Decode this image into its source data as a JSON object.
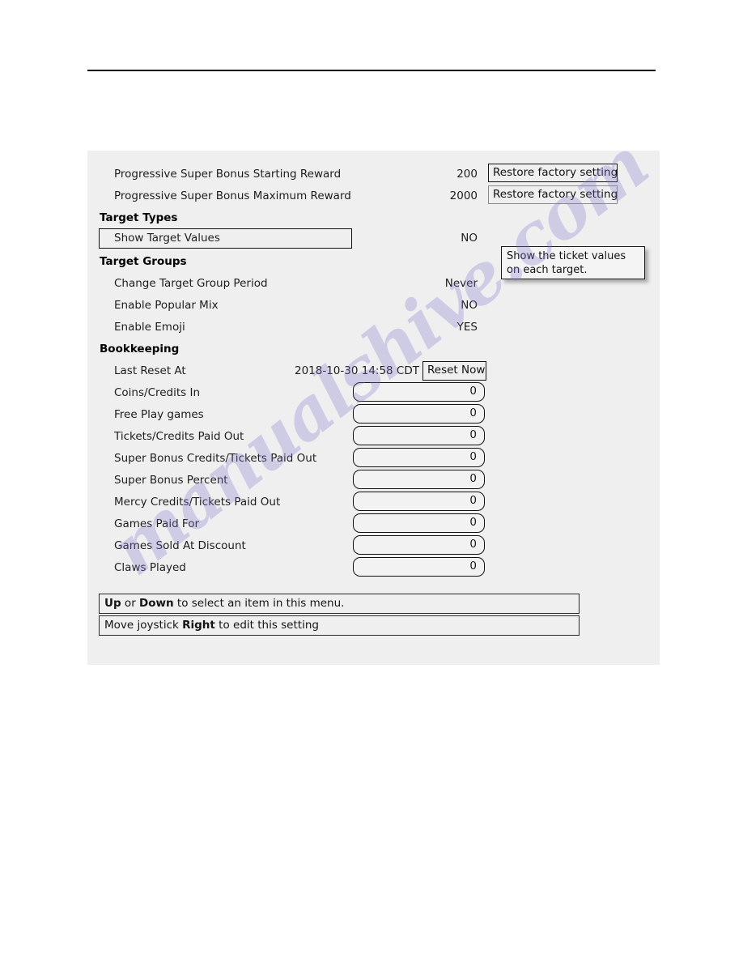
{
  "page": {
    "watermark": "manualshive.com"
  },
  "panel": {
    "rows": [
      {
        "kind": "item",
        "label": "Progressive Super Bonus Starting Reward",
        "value": "200"
      },
      {
        "kind": "item",
        "label": "Progressive Super Bonus Maximum Reward",
        "value": "2000"
      },
      {
        "kind": "group",
        "label": "Target Types",
        "value": ""
      },
      {
        "kind": "selected",
        "label": "Show Target Values",
        "value": "NO"
      },
      {
        "kind": "group",
        "label": "Target Groups",
        "value": ""
      },
      {
        "kind": "item",
        "label": "Change Target Group Period",
        "value": "Never"
      },
      {
        "kind": "item",
        "label": "Enable Popular Mix",
        "value": "NO"
      },
      {
        "kind": "item",
        "label": "Enable Emoji",
        "value": "YES"
      },
      {
        "kind": "group",
        "label": "Bookkeeping",
        "value": ""
      }
    ],
    "restore_buttons": [
      {
        "label": "Restore factory setting"
      },
      {
        "label": "Restore factory setting"
      }
    ],
    "tooltip": {
      "line1": "Show the ticket values",
      "line2": "on each target."
    },
    "bookkeeping": {
      "last_reset_label": "Last Reset At",
      "last_reset_value": "2018-10-30 14:58 CDT",
      "reset_button": "Reset Now",
      "fields": [
        {
          "label": "Coins/Credits In",
          "value": "0"
        },
        {
          "label": "Free Play games",
          "value": "0"
        },
        {
          "label": "Tickets/Credits Paid Out",
          "value": "0"
        },
        {
          "label": "Super Bonus Credits/Tickets Paid Out",
          "value": "0"
        },
        {
          "label": "Super Bonus Percent",
          "value": "0"
        },
        {
          "label": "Mercy Credits/Tickets Paid Out",
          "value": "0"
        },
        {
          "label": "Games Paid For",
          "value": "0"
        },
        {
          "label": "Games Sold At Discount",
          "value": "0"
        },
        {
          "label": "Claws Played",
          "value": "0"
        }
      ]
    },
    "help": {
      "line1": {
        "strong1": "Up",
        "mid": " or ",
        "strong2": "Down",
        "rest": " to select an item in this menu."
      },
      "line2": {
        "pre": "Move joystick ",
        "strong": "Right",
        "rest": " to edit this setting"
      }
    }
  }
}
